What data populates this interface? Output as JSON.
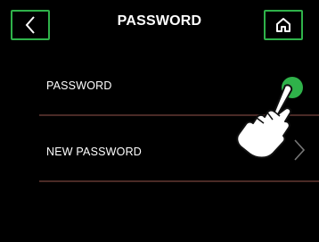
{
  "header": {
    "title": "PASSWORD",
    "back_icon": "chevron-left-icon",
    "home_icon": "home-icon"
  },
  "settings": [
    {
      "label": "PASSWORD",
      "control": "toggle",
      "state": "on"
    },
    {
      "label": "NEW PASSWORD",
      "control": "chevron-right-icon"
    }
  ],
  "colors": {
    "background": "#000000",
    "accent": "#2fb24a",
    "divider": "#4a2a26",
    "text": "#ffffff"
  },
  "overlay": {
    "icon": "pointing-hand-icon"
  }
}
